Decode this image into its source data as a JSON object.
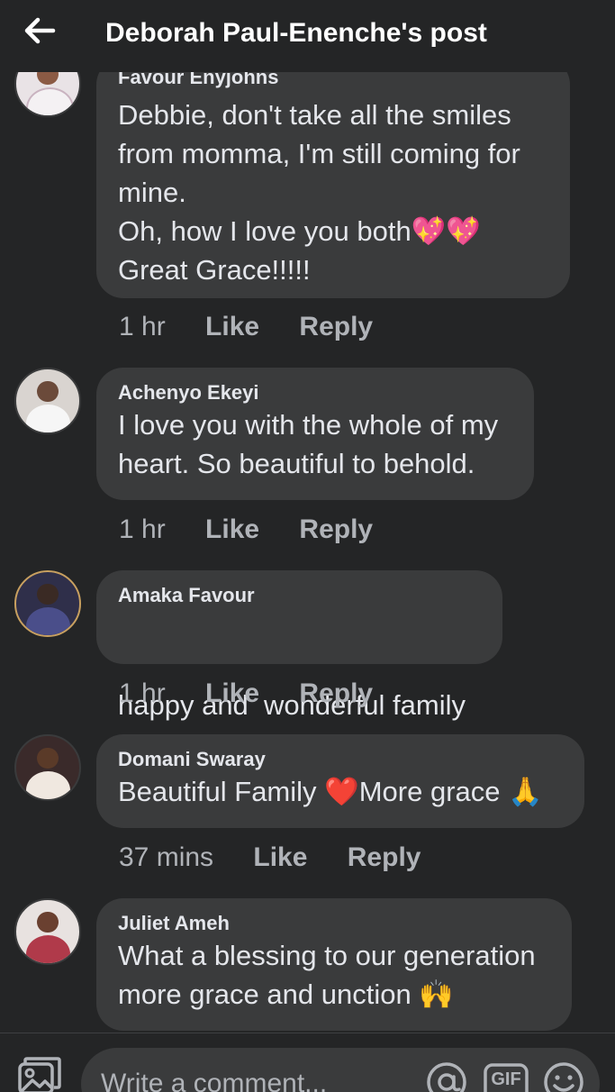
{
  "header": {
    "title": "Deborah Paul-Enenche's post"
  },
  "comments": [
    {
      "author": "Favour Enyjohns",
      "lines": [
        "Debbie, don't take all the smiles from momma, I'm still coming for mine.",
        "Oh, how I love you both💖💖",
        "Great Grace!!!!!"
      ],
      "time": "1 hr",
      "like_label": "Like",
      "reply_label": "Reply",
      "avatar_color": "#e9e3e6"
    },
    {
      "author": "Achenyo Ekeyi",
      "lines": [
        "I love you with the whole of my heart. So beautiful to behold."
      ],
      "time": "1 hr",
      "like_label": "Like",
      "reply_label": "Reply",
      "avatar_color": "#d9d4d0"
    },
    {
      "author": "Amaka Favour",
      "lines": [
        "happy and  wonderful family"
      ],
      "time": "1 hr",
      "like_label": "Like",
      "reply_label": "Reply",
      "avatar_color": "#4a4e8a"
    },
    {
      "author": "Domani Swaray",
      "lines": [
        "Beautiful Family ❤️More grace 🙏"
      ],
      "time": "37 mins",
      "like_label": "Like",
      "reply_label": "Reply",
      "avatar_color": "#7a4a2a"
    },
    {
      "author": "Juliet Ameh",
      "lines": [
        "What a blessing to our generation more grace and unction 🙌"
      ],
      "time": "",
      "like_label": "",
      "reply_label": "",
      "avatar_color": "#b03a4a"
    }
  ],
  "composer": {
    "placeholder": "Write a comment...",
    "gif_label": "GIF"
  },
  "colors": {
    "background": "#242526",
    "bubble": "#3a3b3c",
    "text": "#e4e6eb",
    "secondary_text": "#b0b3b8"
  },
  "icons": {
    "back": "arrow-left-icon",
    "photo": "photo-icon",
    "mention": "at-sign-icon",
    "gif": "gif-icon",
    "emoji": "smiley-icon"
  }
}
